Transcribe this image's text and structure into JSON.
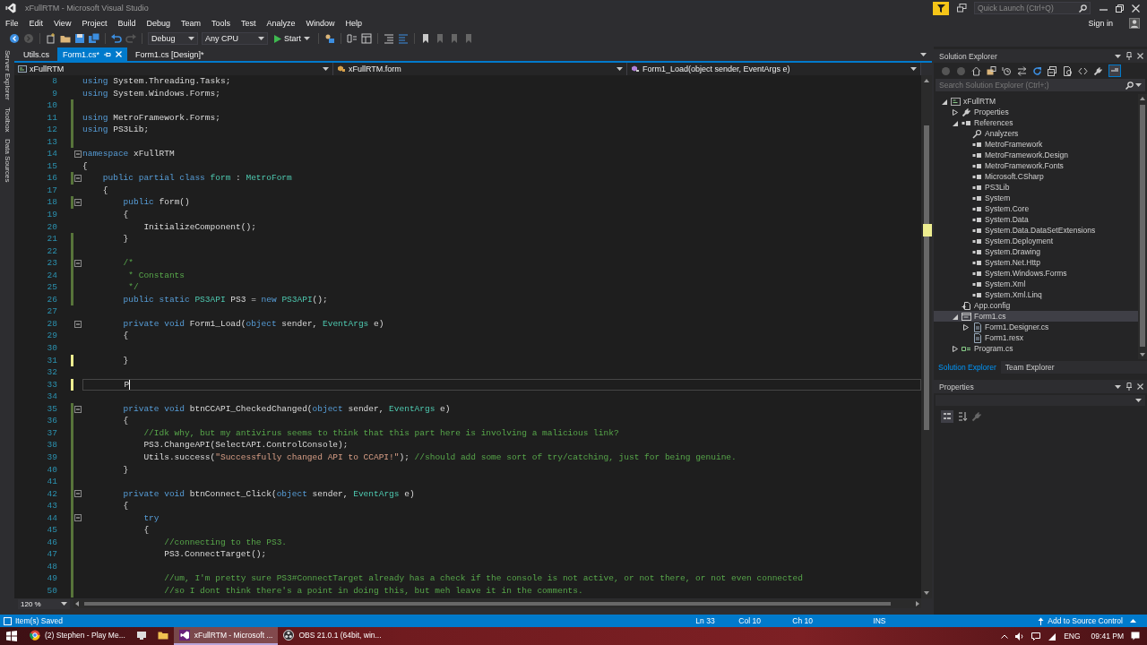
{
  "window": {
    "title": "xFullRTM - Microsoft Visual Studio",
    "quick_launch": {
      "placeholder": "Quick Launch (Ctrl+Q)"
    },
    "sign_in": "Sign in"
  },
  "menu": [
    "File",
    "Edit",
    "View",
    "Project",
    "Build",
    "Debug",
    "Team",
    "Tools",
    "Test",
    "Analyze",
    "Window",
    "Help"
  ],
  "toolbar": {
    "configuration": "Debug",
    "platform": "Any CPU",
    "start": "Start"
  },
  "side_tabs": [
    "Server Explorer",
    "Toolbox",
    "Data Sources"
  ],
  "tabs": [
    {
      "label": "Utils.cs",
      "selected": false
    },
    {
      "label": "Form1.cs*",
      "selected": true
    },
    {
      "label": "Form1.cs [Design]*",
      "selected": false
    }
  ],
  "navigation_bar": {
    "project": "xFullRTM",
    "type": "xFullRTM.form",
    "member": "Form1_Load(object sender, EventArgs e)"
  },
  "code": {
    "lines": [
      {
        "number": "8",
        "tokens": [
          {
            "kind": "kw",
            "text": "using"
          },
          {
            "kind": "plain",
            "text": " System.Threading.Tasks;"
          }
        ],
        "modified": false,
        "foldable": false,
        "current": false
      },
      {
        "number": "9",
        "tokens": [
          {
            "kind": "kw",
            "text": "using"
          },
          {
            "kind": "plain",
            "text": " System.Windows.Forms;"
          }
        ],
        "modified": false,
        "foldable": false,
        "current": false
      },
      {
        "number": "10",
        "modified": true,
        "saved": true,
        "foldable": false,
        "current": false
      },
      {
        "number": "11",
        "tokens": [
          {
            "kind": "kw",
            "text": "using"
          },
          {
            "kind": "plain",
            "text": " MetroFramework.Forms;"
          }
        ],
        "modified": true,
        "saved": true,
        "foldable": false,
        "current": false
      },
      {
        "number": "12",
        "tokens": [
          {
            "kind": "kw",
            "text": "using"
          },
          {
            "kind": "plain",
            "text": " PS3Lib;"
          }
        ],
        "modified": true,
        "saved": true,
        "foldable": false,
        "current": false
      },
      {
        "number": "13",
        "modified": true,
        "saved": true,
        "foldable": false,
        "current": false
      },
      {
        "number": "14",
        "tokens": [
          {
            "kind": "kw",
            "text": "namespace"
          },
          {
            "kind": "plain",
            "text": " xFullRTM"
          }
        ],
        "modified": false,
        "foldable": true,
        "current": false
      },
      {
        "number": "15",
        "tokens": [
          {
            "kind": "plain",
            "text": "{"
          }
        ],
        "modified": false,
        "foldable": false,
        "current": false
      },
      {
        "number": "16",
        "tokens": [
          {
            "kind": "kw",
            "text": "    public partial class "
          },
          {
            "kind": "type",
            "text": "form"
          },
          {
            "kind": "plain",
            "text": " : "
          },
          {
            "kind": "type",
            "text": "MetroForm"
          }
        ],
        "modified": true,
        "saved": true,
        "foldable": true,
        "current": false
      },
      {
        "number": "17",
        "tokens": [
          {
            "kind": "plain",
            "text": "    {"
          }
        ],
        "modified": false,
        "foldable": false,
        "current": false
      },
      {
        "number": "18",
        "tokens": [
          {
            "kind": "kw",
            "text": "        public"
          },
          {
            "kind": "plain",
            "text": " form()"
          }
        ],
        "modified": true,
        "saved": true,
        "foldable": true,
        "current": false
      },
      {
        "number": "19",
        "tokens": [
          {
            "kind": "plain",
            "text": "        {"
          }
        ],
        "modified": false,
        "foldable": false,
        "current": false
      },
      {
        "number": "20",
        "tokens": [
          {
            "kind": "plain",
            "text": "            InitializeComponent();"
          }
        ],
        "modified": false,
        "foldable": false,
        "current": false
      },
      {
        "number": "21",
        "tokens": [
          {
            "kind": "plain",
            "text": "        }"
          }
        ],
        "modified": true,
        "saved": true,
        "foldable": false,
        "current": false
      },
      {
        "number": "22",
        "modified": true,
        "saved": true,
        "foldable": false,
        "current": false
      },
      {
        "number": "23",
        "tokens": [
          {
            "kind": "comment",
            "text": "        /*"
          }
        ],
        "modified": true,
        "saved": true,
        "foldable": true,
        "current": false
      },
      {
        "number": "24",
        "tokens": [
          {
            "kind": "comment",
            "text": "         * Constants"
          }
        ],
        "modified": true,
        "saved": true,
        "foldable": false,
        "current": false
      },
      {
        "number": "25",
        "tokens": [
          {
            "kind": "comment",
            "text": "         */"
          }
        ],
        "modified": true,
        "saved": true,
        "foldable": false,
        "current": false
      },
      {
        "number": "26",
        "tokens": [
          {
            "kind": "kw",
            "text": "        public static "
          },
          {
            "kind": "type",
            "text": "PS3API"
          },
          {
            "kind": "plain",
            "text": " PS3 = "
          },
          {
            "kind": "kw",
            "text": "new "
          },
          {
            "kind": "type",
            "text": "PS3API"
          },
          {
            "kind": "plain",
            "text": "();"
          }
        ],
        "modified": true,
        "saved": true,
        "foldable": false,
        "current": false
      },
      {
        "number": "27",
        "modified": false,
        "foldable": false,
        "current": false
      },
      {
        "number": "28",
        "tokens": [
          {
            "kind": "kw",
            "text": "        private void"
          },
          {
            "kind": "plain",
            "text": " Form1_Load("
          },
          {
            "kind": "kw",
            "text": "object"
          },
          {
            "kind": "plain",
            "text": " sender, "
          },
          {
            "kind": "type",
            "text": "EventArgs"
          },
          {
            "kind": "plain",
            "text": " e)"
          }
        ],
        "modified": false,
        "foldable": true,
        "current": false
      },
      {
        "number": "29",
        "tokens": [
          {
            "kind": "plain",
            "text": "        {"
          }
        ],
        "modified": false,
        "foldable": false,
        "current": false
      },
      {
        "number": "30",
        "modified": false,
        "foldable": false,
        "current": false
      },
      {
        "number": "31",
        "tokens": [
          {
            "kind": "plain",
            "text": "        }"
          }
        ],
        "modified": true,
        "saved": false,
        "foldable": false,
        "current": false
      },
      {
        "number": "32",
        "modified": false,
        "foldable": false,
        "current": false
      },
      {
        "number": "33",
        "tokens": [
          {
            "kind": "plain",
            "text": "        P"
          }
        ],
        "modified": true,
        "saved": false,
        "foldable": false,
        "current": true
      },
      {
        "number": "34",
        "modified": false,
        "foldable": false,
        "current": false
      },
      {
        "number": "35",
        "tokens": [
          {
            "kind": "kw",
            "text": "        private void"
          },
          {
            "kind": "plain",
            "text": " btnCCAPI_CheckedChanged("
          },
          {
            "kind": "kw",
            "text": "object"
          },
          {
            "kind": "plain",
            "text": " sender, "
          },
          {
            "kind": "type",
            "text": "EventArgs"
          },
          {
            "kind": "plain",
            "text": " e)"
          }
        ],
        "modified": true,
        "saved": true,
        "foldable": true,
        "current": false
      },
      {
        "number": "36",
        "tokens": [
          {
            "kind": "plain",
            "text": "        {"
          }
        ],
        "modified": true,
        "saved": true,
        "foldable": false,
        "current": false
      },
      {
        "number": "37",
        "tokens": [
          {
            "kind": "comment",
            "text": "            //Idk why, but my antivirus seems to think that this part here is involving a malicious link?"
          }
        ],
        "modified": true,
        "saved": true,
        "foldable": false,
        "current": false
      },
      {
        "number": "38",
        "tokens": [
          {
            "kind": "plain",
            "text": "            PS3.ChangeAPI(SelectAPI.ControlConsole);"
          }
        ],
        "modified": true,
        "saved": true,
        "foldable": false,
        "current": false
      },
      {
        "number": "39",
        "tokens": [
          {
            "kind": "plain",
            "text": "            Utils.success("
          },
          {
            "kind": "string",
            "text": "\"Successfully changed API to CCAPI!\""
          },
          {
            "kind": "plain",
            "text": "); "
          },
          {
            "kind": "comment",
            "text": "//should add some sort of try/catching, just for being genuine."
          }
        ],
        "modified": true,
        "saved": true,
        "foldable": false,
        "current": false
      },
      {
        "number": "40",
        "tokens": [
          {
            "kind": "plain",
            "text": "        }"
          }
        ],
        "modified": true,
        "saved": true,
        "foldable": false,
        "current": false
      },
      {
        "number": "41",
        "modified": true,
        "saved": true,
        "foldable": false,
        "current": false
      },
      {
        "number": "42",
        "tokens": [
          {
            "kind": "kw",
            "text": "        private void"
          },
          {
            "kind": "plain",
            "text": " btnConnect_Click("
          },
          {
            "kind": "kw",
            "text": "object"
          },
          {
            "kind": "plain",
            "text": " sender, "
          },
          {
            "kind": "type",
            "text": "EventArgs"
          },
          {
            "kind": "plain",
            "text": " e)"
          }
        ],
        "modified": true,
        "saved": true,
        "foldable": true,
        "current": false
      },
      {
        "number": "43",
        "tokens": [
          {
            "kind": "plain",
            "text": "        {"
          }
        ],
        "modified": true,
        "saved": true,
        "foldable": false,
        "current": false
      },
      {
        "number": "44",
        "tokens": [
          {
            "kind": "kw",
            "text": "            try"
          }
        ],
        "modified": true,
        "saved": true,
        "foldable": true,
        "current": false
      },
      {
        "number": "45",
        "tokens": [
          {
            "kind": "plain",
            "text": "            {"
          }
        ],
        "modified": true,
        "saved": true,
        "foldable": false,
        "current": false
      },
      {
        "number": "46",
        "tokens": [
          {
            "kind": "comment",
            "text": "                //connecting to the PS3."
          }
        ],
        "modified": true,
        "saved": true,
        "foldable": false,
        "current": false
      },
      {
        "number": "47",
        "tokens": [
          {
            "kind": "plain",
            "text": "                PS3.ConnectTarget();"
          }
        ],
        "modified": true,
        "saved": true,
        "foldable": false,
        "current": false
      },
      {
        "number": "48",
        "modified": true,
        "saved": true,
        "foldable": false,
        "current": false
      },
      {
        "number": "49",
        "tokens": [
          {
            "kind": "comment",
            "text": "                //um, I'm pretty sure PS3#ConnectTarget already has a check if the console is not active, or not there, or not even connected"
          }
        ],
        "modified": true,
        "saved": true,
        "foldable": false,
        "current": false
      },
      {
        "number": "50",
        "tokens": [
          {
            "kind": "comment",
            "text": "                //so I dont think there's a point in doing this, but meh leave it in the comments."
          }
        ],
        "modified": true,
        "saved": true,
        "foldable": false,
        "current": false
      }
    ],
    "zoom": "120 %"
  },
  "solution_explorer": {
    "title": "Solution Explorer",
    "search": {
      "placeholder": "Search Solution Explorer (Ctrl+;)"
    },
    "tree": [
      {
        "label": "xFullRTM",
        "kind": "project",
        "expanded": true,
        "selected": false,
        "children": [
          {
            "label": "Properties",
            "kind": "properties",
            "expanded": false,
            "selected": false
          },
          {
            "label": "References",
            "kind": "reference",
            "expanded": true,
            "selected": false,
            "children": [
              {
                "label": "Analyzers",
                "kind": "analyzer",
                "selected": false
              },
              {
                "label": "MetroFramework",
                "kind": "reference",
                "selected": false
              },
              {
                "label": "MetroFramework.Design",
                "kind": "reference",
                "selected": false
              },
              {
                "label": "MetroFramework.Fonts",
                "kind": "reference",
                "selected": false
              },
              {
                "label": "Microsoft.CSharp",
                "kind": "reference",
                "selected": false
              },
              {
                "label": "PS3Lib",
                "kind": "reference",
                "selected": false
              },
              {
                "label": "System",
                "kind": "reference",
                "selected": false
              },
              {
                "label": "System.Core",
                "kind": "reference",
                "selected": false
              },
              {
                "label": "System.Data",
                "kind": "reference",
                "selected": false
              },
              {
                "label": "System.Data.DataSetExtensions",
                "kind": "reference",
                "selected": false
              },
              {
                "label": "System.Deployment",
                "kind": "reference",
                "selected": false
              },
              {
                "label": "System.Drawing",
                "kind": "reference",
                "selected": false
              },
              {
                "label": "System.Net.Http",
                "kind": "reference",
                "selected": false
              },
              {
                "label": "System.Windows.Forms",
                "kind": "reference",
                "selected": false
              },
              {
                "label": "System.Xml",
                "kind": "reference",
                "selected": false
              },
              {
                "label": "System.Xml.Linq",
                "kind": "reference",
                "selected": false
              }
            ]
          },
          {
            "label": "App.config",
            "kind": "config",
            "selected": false
          },
          {
            "label": "Form1.cs",
            "kind": "form",
            "expanded": true,
            "selected": true,
            "children": [
              {
                "label": "Form1.Designer.cs",
                "kind": "file",
                "expanded": false,
                "selected": false
              },
              {
                "label": "Form1.resx",
                "kind": "file",
                "selected": false
              }
            ]
          },
          {
            "label": "Program.cs",
            "kind": "source",
            "expanded": false,
            "selected": false
          }
        ]
      }
    ],
    "tabs": [
      {
        "label": "Solution Explorer",
        "selected": true
      },
      {
        "label": "Team Explorer",
        "selected": false
      }
    ]
  },
  "properties": {
    "title": "Properties"
  },
  "status_bar": {
    "message": "Item(s) Saved",
    "line": "Ln 33",
    "column": "Col 10",
    "char": "Ch 10",
    "mode": "INS",
    "source_control": "Add to Source Control"
  },
  "taskbar": {
    "apps": [
      {
        "kind": "browser",
        "label": "(2) Stephen - Play Me...",
        "selected": false
      },
      {
        "kind": "app",
        "selected": false
      },
      {
        "kind": "folder",
        "selected": false
      },
      {
        "kind": "ide",
        "label": "xFullRTM - Microsoft ...",
        "selected": true
      },
      {
        "kind": "recorder",
        "label": "OBS 21.0.1 (64bit, win...",
        "selected": false
      }
    ],
    "language": "ENG",
    "time": "09:41 PM"
  }
}
